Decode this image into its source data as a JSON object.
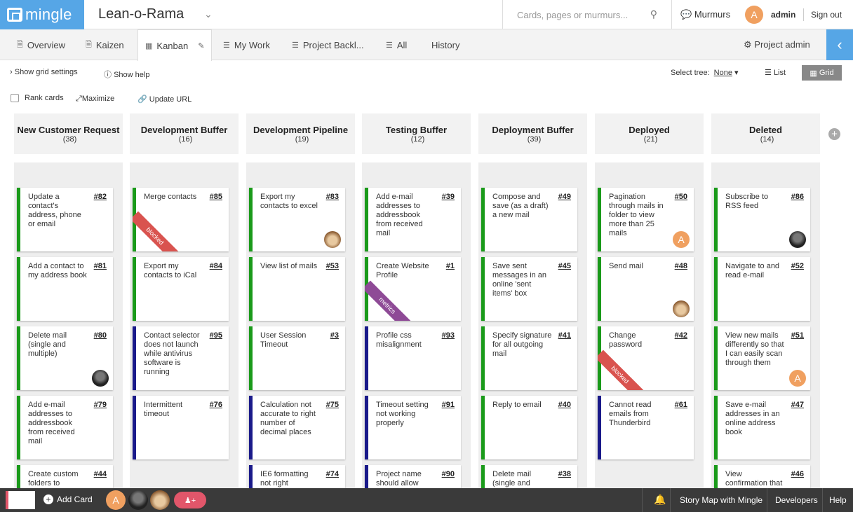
{
  "app": {
    "logo_text": "mingle",
    "project": "Lean-o-Rama"
  },
  "search": {
    "placeholder": "Cards, pages or murmurs..."
  },
  "header": {
    "murmurs": "Murmurs",
    "user_initial": "A",
    "user": "admin",
    "signout": "Sign out"
  },
  "tabs": [
    {
      "label": "Overview",
      "icon": "page-icon"
    },
    {
      "label": "Kaizen",
      "icon": "page-icon"
    },
    {
      "label": "Kanban",
      "icon": "grid-icon",
      "active": true
    },
    {
      "label": "My Work",
      "icon": "list-icon"
    },
    {
      "label": "Project Backl...",
      "icon": "list-icon"
    },
    {
      "label": "All",
      "icon": "list-icon"
    },
    {
      "label": "History"
    }
  ],
  "project_admin": "Project admin",
  "options": {
    "grid_settings": "Show grid settings",
    "help": "Show help",
    "select_tree": "Select tree:",
    "tree_value": "None",
    "list": "List",
    "grid": "Grid",
    "rank": "Rank cards",
    "maximize": "Maximize",
    "update_url": "Update URL"
  },
  "columns": [
    {
      "title": "New Customer Request",
      "count": "(38)",
      "cards": [
        {
          "title": "Update a contact's address, phone or email",
          "num": "#82",
          "color": "#1a9a1a"
        },
        {
          "title": "Add a contact to my address book",
          "num": "#81",
          "color": "#1a9a1a"
        },
        {
          "title": "Delete mail (single and multiple)",
          "num": "#80",
          "color": "#1a9a1a",
          "avatar": "dark"
        },
        {
          "title": "Add e-mail addresses to addressbook from received mail",
          "num": "#79",
          "color": "#1a9a1a"
        },
        {
          "title": "Create custom folders to organize",
          "num": "#44",
          "color": "#1a9a1a"
        }
      ]
    },
    {
      "title": "Development Buffer",
      "count": "(16)",
      "cards": [
        {
          "title": "Merge contacts",
          "num": "#85",
          "color": "#1a9a1a",
          "ribbon": "blocked",
          "ribbon_color": "#d9534f"
        },
        {
          "title": "Export my contacts to iCal",
          "num": "#84",
          "color": "#1a9a1a"
        },
        {
          "title": "Contact selector does not launch while antivirus software is running",
          "num": "#95",
          "color": "#1a1a8a"
        },
        {
          "title": "Intermittent timeout",
          "num": "#76",
          "color": "#1a1a8a"
        }
      ]
    },
    {
      "title": "Development Pipeline",
      "count": "(19)",
      "cards": [
        {
          "title": "Export my contacts to excel",
          "num": "#83",
          "color": "#1a9a1a",
          "avatar": "dog"
        },
        {
          "title": "View list of mails",
          "num": "#53",
          "color": "#1a9a1a"
        },
        {
          "title": "User Session Timeout",
          "num": "#3",
          "color": "#1a9a1a"
        },
        {
          "title": "Calculation not accurate to right number of decimal places",
          "num": "#75",
          "color": "#1a1a8a"
        },
        {
          "title": "IE6 formatting not right",
          "num": "#74",
          "color": "#1a1a8a"
        }
      ]
    },
    {
      "title": "Testing Buffer",
      "count": "(12)",
      "cards": [
        {
          "title": "Add e-mail addresses to addressbook from received mail",
          "num": "#39",
          "color": "#1a9a1a"
        },
        {
          "title": "Create Website Profile",
          "num": "#1",
          "color": "#1a9a1a",
          "ribbon": "metrics",
          "ribbon_color": "#8e4a96"
        },
        {
          "title": "Profile css misalignment",
          "num": "#93",
          "color": "#1a1a8a"
        },
        {
          "title": "Timeout setting not working properly",
          "num": "#91",
          "color": "#1a1a8a"
        },
        {
          "title": "Project name should allow mixed case",
          "num": "#90",
          "color": "#1a1a8a"
        }
      ]
    },
    {
      "title": "Deployment Buffer",
      "count": "(39)",
      "cards": [
        {
          "title": "Compose and save (as a draft) a new mail",
          "num": "#49",
          "color": "#1a9a1a"
        },
        {
          "title": "Save sent messages in an online 'sent items' box",
          "num": "#45",
          "color": "#1a9a1a"
        },
        {
          "title": "Specify signature for all outgoing mail",
          "num": "#41",
          "color": "#1a9a1a"
        },
        {
          "title": "Reply to email",
          "num": "#40",
          "color": "#1a9a1a"
        },
        {
          "title": "Delete mail (single and multiple)",
          "num": "#38",
          "color": "#1a9a1a"
        }
      ]
    },
    {
      "title": "Deployed",
      "count": "(21)",
      "cards": [
        {
          "title": "Pagination through mails in folder to view more than 25 mails",
          "num": "#50",
          "color": "#1a9a1a",
          "avatar": "A"
        },
        {
          "title": "Send mail",
          "num": "#48",
          "color": "#1a9a1a",
          "avatar": "dog"
        },
        {
          "title": "Change password",
          "num": "#42",
          "color": "#1a9a1a",
          "ribbon": "blocked",
          "ribbon_color": "#d9534f"
        },
        {
          "title": "Cannot read emails from Thunderbird",
          "num": "#61",
          "color": "#1a1a8a"
        }
      ]
    },
    {
      "title": "Deleted",
      "count": "(14)",
      "cards": [
        {
          "title": "Subscribe to RSS feed",
          "num": "#86",
          "color": "#1a9a1a",
          "avatar": "dark"
        },
        {
          "title": "Navigate to and read e-mail",
          "num": "#52",
          "color": "#1a9a1a"
        },
        {
          "title": "View new mails differently so that I can easily scan through them",
          "num": "#51",
          "color": "#1a9a1a",
          "avatar": "A"
        },
        {
          "title": "Save e-mail addresses in an online address book",
          "num": "#47",
          "color": "#1a9a1a"
        },
        {
          "title": "View confirmation that e-mail was sent",
          "num": "#46",
          "color": "#1a9a1a"
        }
      ]
    }
  ],
  "bottom": {
    "add_card": "Add Card",
    "story_map": "Story Map with Mingle",
    "developers": "Developers",
    "help": "Help"
  }
}
